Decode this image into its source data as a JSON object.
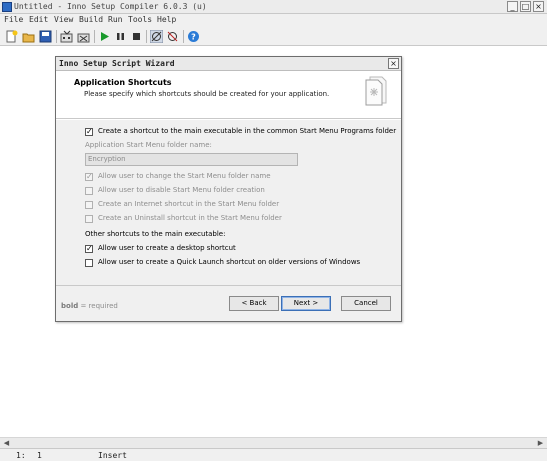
{
  "window": {
    "title": "Untitled - Inno Setup Compiler 6.0.3 (u)",
    "controls": {
      "minimize": "_",
      "maximize": "□",
      "close": "×"
    }
  },
  "menubar": {
    "items": [
      "File",
      "Edit",
      "View",
      "Build",
      "Run",
      "Tools",
      "Help"
    ]
  },
  "toolbar": {
    "buttons": [
      "new-file-icon",
      "open-file-icon",
      "save-icon",
      "compile-icon",
      "stop-compile-icon",
      "run-icon",
      "pause-icon",
      "terminate-icon",
      "target-setup-icon",
      "target-uninstall-icon",
      "help-icon"
    ]
  },
  "wizard": {
    "title": "Inno Setup Script Wizard",
    "close_label": "×",
    "header_title": "Application Shortcuts",
    "header_subtitle": "Please specify which shortcuts should be created for your application.",
    "options": {
      "start_menu": {
        "label": "Create a shortcut to the main executable in the common Start Menu Programs folder",
        "checked": true,
        "enabled": true
      },
      "folder_label": "Application Start Menu folder name:",
      "folder_value": "Encryption",
      "allow_change": {
        "label": "Allow user to change the Start Menu folder name",
        "checked": true,
        "enabled": false
      },
      "allow_disable": {
        "label": "Allow user to disable Start Menu folder creation",
        "checked": false,
        "enabled": false
      },
      "internet_shortcut": {
        "label": "Create an Internet shortcut in the Start Menu folder",
        "checked": false,
        "enabled": false
      },
      "uninstall_shortcut": {
        "label": "Create an Uninstall shortcut in the Start Menu folder",
        "checked": false,
        "enabled": false
      },
      "other_heading": "Other shortcuts to the main executable:",
      "desktop": {
        "label": "Allow user to create a desktop shortcut",
        "checked": true,
        "enabled": true
      },
      "quick_launch": {
        "label": "Allow user to create a Quick Launch shortcut on older versions of Windows",
        "checked": false,
        "enabled": true
      }
    },
    "footer": {
      "note_bold": "bold",
      "note_rest": " = required",
      "back_label": "< Back",
      "next_label": "Next >",
      "cancel_label": "Cancel"
    }
  },
  "statusbar": {
    "line": "1:",
    "column": "1",
    "mode": "Insert"
  },
  "colors": {
    "accent": "#3b6fb6",
    "disabled_text": "#8d8d8d",
    "dialog_bg": "#f0f0f0"
  }
}
